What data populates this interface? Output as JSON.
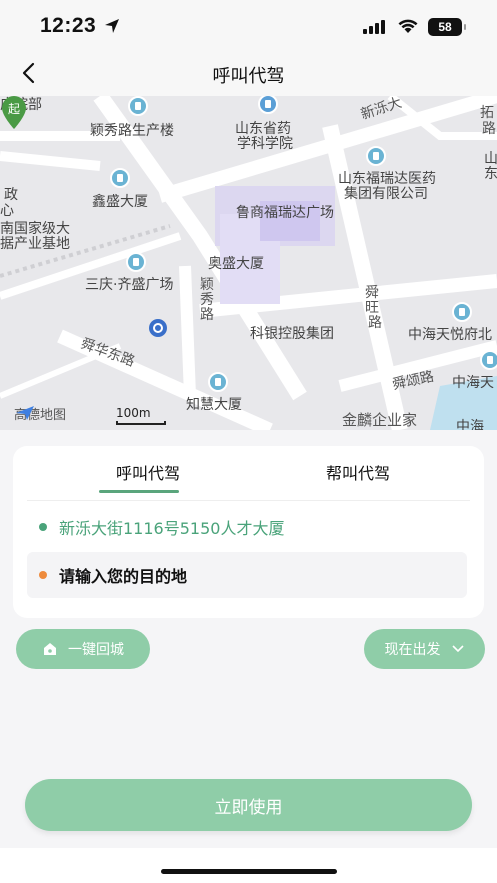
{
  "status": {
    "time": "12:23",
    "battery": "58"
  },
  "nav": {
    "title": "呼叫代驾"
  },
  "map": {
    "labels": {
      "l1": "庄院部",
      "l2": "颖秀路生产楼",
      "l3": "山东省药",
      "l4": "学科学院",
      "l5": "新泺大",
      "l6": "山东福瑞达医药",
      "l7": "集团有限公司",
      "l8": "鑫盛大厦",
      "l9": "政",
      "l10": "心",
      "l11": "南国家级大",
      "l12": "据产业基地",
      "l13": "鲁商福瑞达广场",
      "l14": "奥盛大厦",
      "l15": "三庆·齐盛广场",
      "l16": "颖",
      "l17": "秀",
      "l18": "路",
      "l19": "舜",
      "l20": "旺",
      "l21": "路",
      "l22": "科银控股集团",
      "l23": "中海天悦府北",
      "l24": "舜华东路",
      "l25": "知慧大厦",
      "l26": "舜颂路",
      "l27": "中海天",
      "l28": "金麟企业家",
      "l29": "中海",
      "l30": "拓",
      "l31": "路",
      "l32": "山",
      "l33": "东"
    },
    "pin_char": "起",
    "attribution": "高德地图",
    "scale": "100m"
  },
  "card": {
    "tabs": [
      "呼叫代驾",
      "帮叫代驾"
    ],
    "from": "新泺大街1116号5150人才大厦",
    "to_placeholder": "请输入您的目的地"
  },
  "chips": {
    "home": "一键回城",
    "time": "现在出发"
  },
  "primary_button": "立即使用",
  "colors": {
    "accent": "#8fcda8",
    "accent_dark": "#4aa37a",
    "dest_dot": "#ee8b3d"
  }
}
